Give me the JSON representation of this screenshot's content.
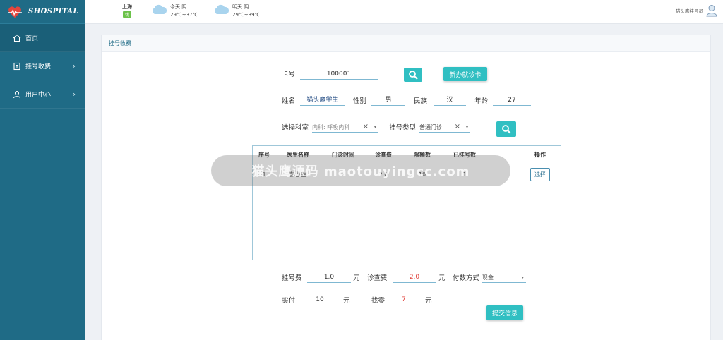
{
  "app": {
    "logo_text": "SHOSPITAL"
  },
  "sidebar": {
    "items": [
      {
        "label": "首页",
        "icon": "home-icon"
      },
      {
        "label": "挂号收费",
        "icon": "register-icon"
      },
      {
        "label": "用户中心",
        "icon": "user-icon"
      }
    ]
  },
  "header": {
    "city": "上海",
    "air_quality": "优",
    "today": {
      "label": "今天 阴",
      "temp": "29℃~37℃"
    },
    "tomorrow": {
      "label": "明天 阴",
      "temp": "29℃~39℃"
    },
    "user_name": "猫头鹰挂号员"
  },
  "panel": {
    "title": "挂号收费"
  },
  "form": {
    "card_label": "卡号",
    "card_value": "100001",
    "new_card_button": "新办就诊卡",
    "name_label": "姓名",
    "name_value": "猫头鹰学生",
    "gender_label": "性别",
    "gender_value": "男",
    "ethnicity_label": "民族",
    "ethnicity_value": "汉",
    "age_label": "年龄",
    "age_value": "27",
    "dept_label": "选择科室",
    "dept_value": "内科: 呼吸内科",
    "reg_type_label": "挂号类型",
    "reg_type_value": "普通门诊",
    "clear_glyph": "×",
    "caret_glyph": "▾"
  },
  "table": {
    "headers": [
      "序号",
      "医生名称",
      "门诊时间",
      "诊查费",
      "限额数",
      "已挂号数",
      "",
      "操作"
    ],
    "rows": [
      {
        "no": "1",
        "doctor": "彭医生",
        "time": "-",
        "fee": "2.0",
        "limit": "10",
        "booked": "1",
        "action": "选择"
      }
    ]
  },
  "fees": {
    "reg_fee_label": "挂号费",
    "reg_fee_value": "1.0",
    "exam_fee_label": "诊查费",
    "exam_fee_value": "2.0",
    "unit": "元",
    "pay_method_label": "付数方式",
    "pay_method_value": "现金",
    "paid_label": "实付",
    "paid_value": "10",
    "change_label": "找零",
    "change_value": "7",
    "submit_button": "提交信息"
  },
  "watermark": {
    "text": "猫头鹰源码 maotouyingcc.com"
  },
  "colors": {
    "sidebar": "#1f6b86",
    "accent": "#30bfc2",
    "red": "#e0403a"
  }
}
